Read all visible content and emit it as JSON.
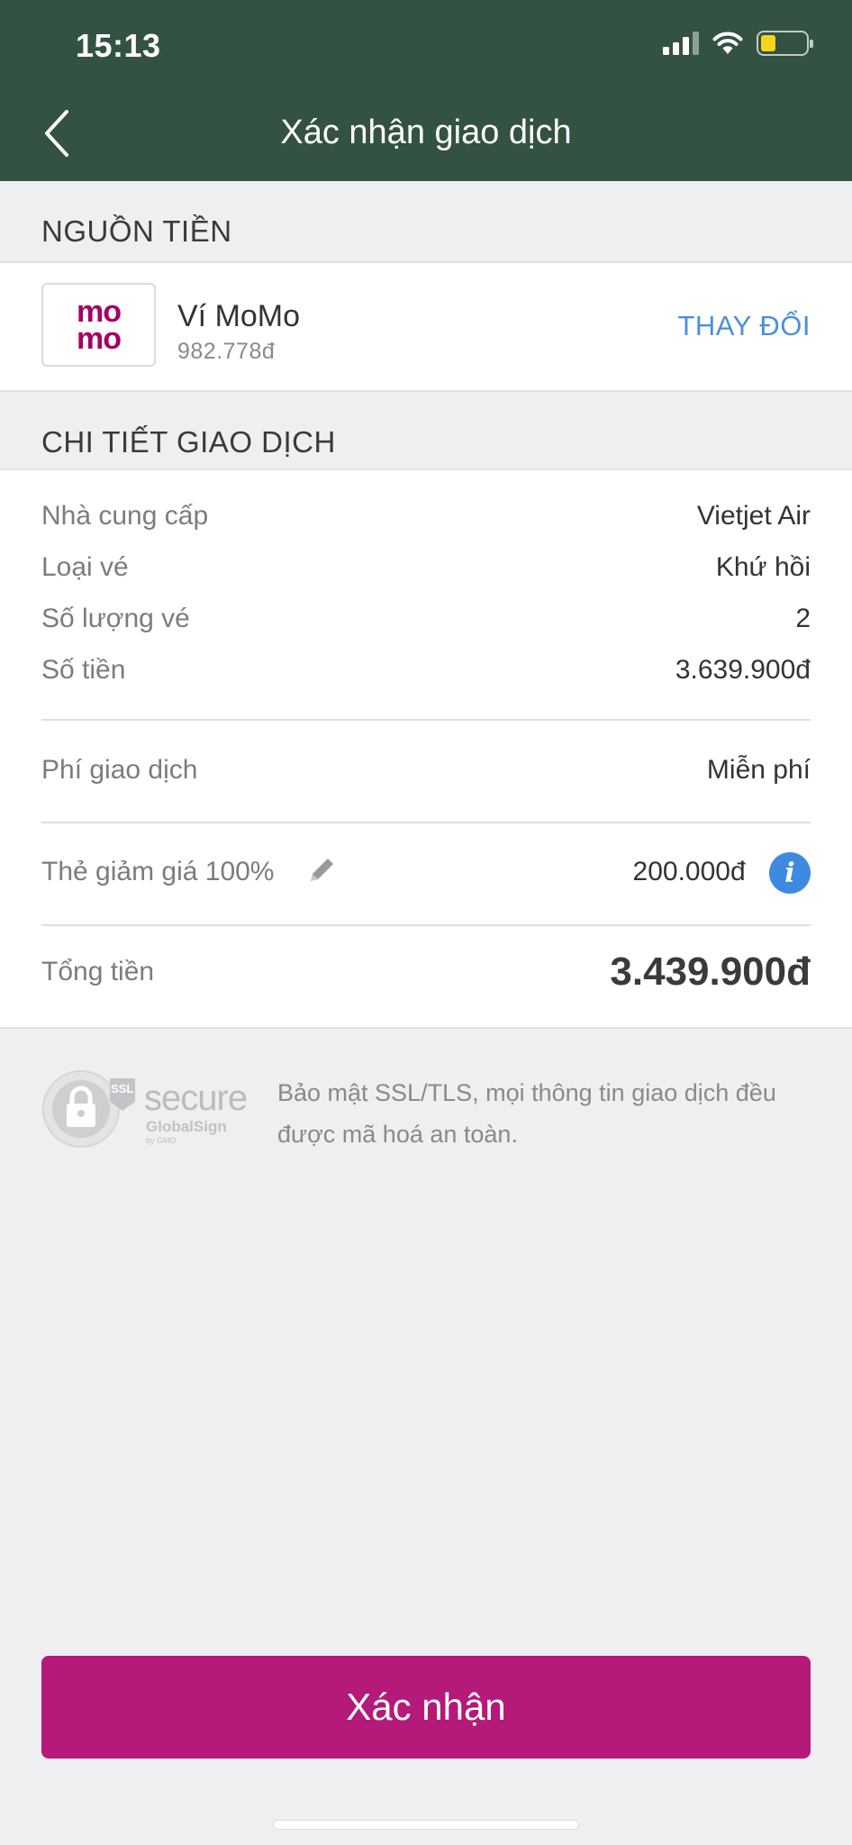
{
  "status_bar": {
    "time": "15:13"
  },
  "header": {
    "title": "Xác nhận giao dịch"
  },
  "source": {
    "section_title": "NGUỒN TIỀN",
    "logo_line1": "mo",
    "logo_line2": "mo",
    "wallet_name": "Ví MoMo",
    "balance": "982.778đ",
    "change_label": "THAY ĐỔI"
  },
  "details": {
    "section_title": "CHI TIẾT GIAO DỊCH",
    "rows": [
      {
        "label": "Nhà cung cấp",
        "value": "Vietjet Air"
      },
      {
        "label": "Loại vé",
        "value": "Khứ hồi"
      },
      {
        "label": "Số lượng vé",
        "value": "2"
      },
      {
        "label": "Số tiền",
        "value": "3.639.900đ"
      }
    ],
    "fee": {
      "label": "Phí giao dịch",
      "value": "Miễn phí"
    },
    "discount": {
      "label": "Thẻ giảm giá 100%",
      "value": "200.000đ",
      "info_glyph": "i"
    },
    "total": {
      "label": "Tổng tiền",
      "value": "3.439.900đ"
    }
  },
  "security": {
    "badge_ssl": "SSL",
    "badge_secure": "secure",
    "badge_brand": "GlobalSign",
    "badge_sub": "by GMO",
    "note": "Bảo mật SSL/TLS, mọi thông tin giao dịch đều được mã hoá an toàn."
  },
  "confirm_button": "Xác nhận",
  "colors": {
    "header_bg": "#335242",
    "accent": "#b5197a",
    "link": "#4a90d9",
    "info": "#3d8ae0",
    "momo": "#a50064"
  }
}
